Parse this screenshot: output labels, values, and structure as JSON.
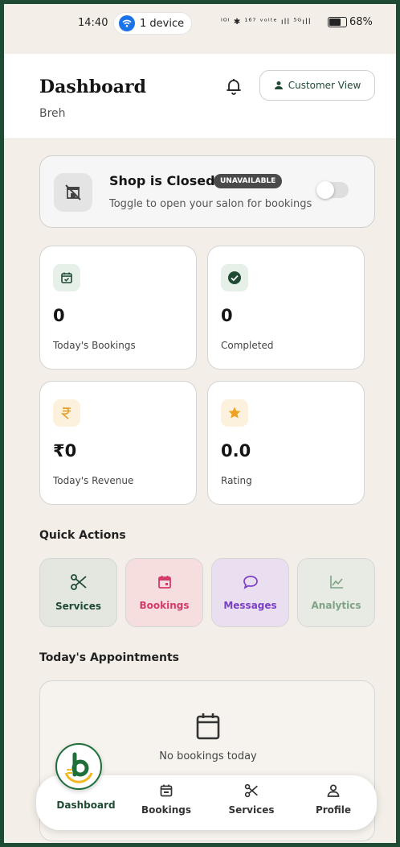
{
  "status_bar": {
    "time": "14:40",
    "device_pill": "1 device",
    "icons_text": "ᴵᴼᴵ ✱ ¹⁶⁷ ᵛᵒˡᵗᵉ ıll ⁵ᴳıll",
    "battery": "68%"
  },
  "header": {
    "title": "Dashboard",
    "subtitle": "Breh",
    "customer_view_label": "Customer View"
  },
  "shop_status": {
    "title": "Shop is Closed",
    "badge": "UNAVAILABLE",
    "subtitle": "Toggle to open your salon for bookings",
    "is_open": false
  },
  "stats": [
    {
      "value": "0",
      "label": "Today's Bookings",
      "icon": "calendar-check-icon",
      "color": "#1f4a34",
      "bg": "#e6efe8"
    },
    {
      "value": "0",
      "label": "Completed",
      "icon": "check-circle-icon",
      "color": "#1f4a34",
      "bg": "#e6efe8"
    },
    {
      "value": "₹0",
      "label": "Today's Revenue",
      "icon": "rupee-icon",
      "color": "#e3a02a",
      "bg": "#fcf1dd"
    },
    {
      "value": "0.0",
      "label": "Rating",
      "icon": "star-icon",
      "color": "#f0a020",
      "bg": "#fcf1dd"
    }
  ],
  "quick_actions": {
    "title": "Quick Actions",
    "items": [
      {
        "label": "Services",
        "icon": "scissors-icon",
        "color": "#1f4a34",
        "bg": "#e3e7df"
      },
      {
        "label": "Bookings",
        "icon": "calendar-icon",
        "color": "#d43a6a",
        "bg": "#f7dede"
      },
      {
        "label": "Messages",
        "icon": "chat-icon",
        "color": "#7b3fc4",
        "bg": "#eadff0"
      },
      {
        "label": "Analytics",
        "icon": "chart-icon",
        "color": "#7fa386",
        "bg": "#e8ebe3"
      }
    ]
  },
  "appointments": {
    "title": "Today's Appointments",
    "empty_text": "No bookings today"
  },
  "bottom_nav": {
    "items": [
      {
        "label": "Dashboard",
        "icon": "logo-icon",
        "active": true
      },
      {
        "label": "Bookings",
        "icon": "calendar-icon",
        "active": false
      },
      {
        "label": "Services",
        "icon": "scissors-icon",
        "active": false
      },
      {
        "label": "Profile",
        "icon": "user-icon",
        "active": false
      }
    ]
  },
  "colors": {
    "brand": "#1f4a34",
    "background": "#f3efe8"
  }
}
